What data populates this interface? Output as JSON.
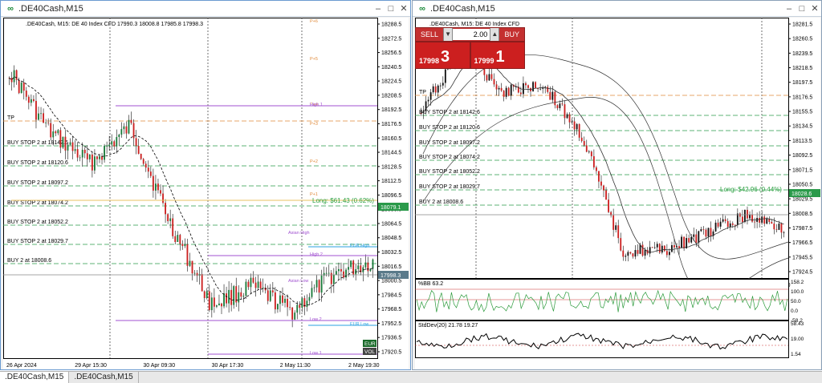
{
  "window1": {
    "title": ".DE40Cash,M15",
    "header": ".DE40Cash, M15:  DE 40 Index CFD  17990.3 18008.8 17985.8 17998.3",
    "yticks": [
      "18288.5",
      "18272.5",
      "18256.5",
      "18240.5",
      "18224.5",
      "18208.5",
      "18192.5",
      "18176.5",
      "18160.5",
      "18144.5",
      "18128.5",
      "18112.5",
      "18096.5",
      "18080.5",
      "18064.5",
      "18048.5",
      "18032.5",
      "18016.5",
      "18000.5",
      "17984.5",
      "17968.5",
      "17952.5",
      "17936.5",
      "17920.5"
    ],
    "xticks": [
      "26 Apr 2024",
      "29 Apr 15:30",
      "30 Apr 09:30",
      "30 Apr 17:30",
      "2 May 11:30",
      "2 May 19:30"
    ],
    "order_labels": [
      "TP",
      "BUY STOP 2 at 18142.6",
      "BUY STOP 2 at 18120.6",
      "BUY STOP 2 at 18097.2",
      "BUY STOP 2 at 18074.2",
      "BUY STOP 2 at 18052.2",
      "BUY STOP 2 at 18029.7",
      "BUY 2 at 18008.6"
    ],
    "level_labels": [
      "P+6",
      "P+5",
      "P+4",
      "P+3",
      "P+2",
      "P+1",
      "High 1",
      "High 2",
      "Asian High",
      "EUR High",
      "EUR Low",
      "Asian Low",
      "Low 1",
      "Low 2"
    ],
    "long_label": "Long:  $61.43 (0.62%)",
    "price_tag_green": "18079.1",
    "price_tag_current": "17998.3",
    "badge_top": "EUR",
    "badge_bottom": "VOL"
  },
  "window2": {
    "title": ".DE40Cash,M15",
    "header": ".DE40Cash, M15:  DE 40 Index CFD",
    "yticks": [
      "18281.5",
      "18260.5",
      "18239.5",
      "18218.5",
      "18197.5",
      "18176.5",
      "18155.5",
      "18134.5",
      "18113.5",
      "18092.5",
      "18071.5",
      "18050.5",
      "18029.5",
      "18008.5",
      "17987.5",
      "17966.5",
      "17945.5",
      "17924.5"
    ],
    "xticks": [
      "26 Apr 2024",
      "26 Apr 22:30",
      "29 Apr 16:30",
      "30 Apr 10:30",
      "30 Apr 18:30",
      "2 May 12:30",
      "2 May 20:30"
    ],
    "order_labels": [
      "TP",
      "BUY STOP 2 at 18142.6",
      "BUY STOP 2 at 18120.6",
      "BUY STOP 2 at 18097.2",
      "BUY STOP 2 at 18074.2",
      "BUY STOP 2 at 18052.2",
      "BUY STOP 2 at 18029.7",
      "BUY 2 at 18008.6"
    ],
    "long_label": "Long:  $42.96 (0.44%)",
    "price_tag_green": "18028.6",
    "price_tag_current": "17998.3",
    "trade_panel": {
      "sell_label": "SELL",
      "buy_label": "BUY",
      "volume": "2.00",
      "sell_small": "17998",
      "sell_big": "3",
      "buy_small": "17999",
      "buy_big": "1"
    },
    "bb_indicator": {
      "label": "%BB 63.2",
      "ticks": [
        "158.2",
        "100.0",
        "50.0",
        "0.0",
        "-58.2"
      ]
    },
    "stddev_indicator": {
      "label": "StdDev(20) 21.78 19.27",
      "ticks": [
        "58.43",
        "19.00",
        "1.54"
      ]
    }
  },
  "tabs": [
    ".DE40Cash,M15",
    ".DE40Cash,M15"
  ],
  "colors": {
    "bull": "#1a7a3a",
    "bear": "#cc2020",
    "order_line": "#2a9a4a",
    "tp_line": "#e08a3a",
    "level_purple": "#a050d0",
    "eur_line": "#2aa0e0"
  }
}
